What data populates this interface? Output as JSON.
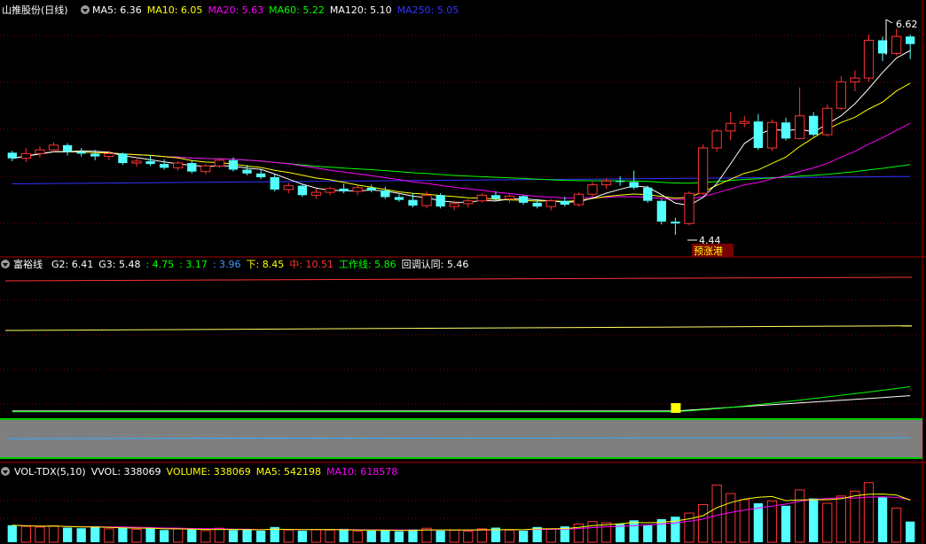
{
  "main_panel": {
    "stock_name": "山推股份(日线)",
    "ma_legend": [
      {
        "label": "MA5: 6.36",
        "color": "#ffffff"
      },
      {
        "label": "MA10: 6.05",
        "color": "#ffff00"
      },
      {
        "label": "MA20: 5.63",
        "color": "#ff00ff"
      },
      {
        "label": "MA60: 5.22",
        "color": "#00ff00"
      },
      {
        "label": "MA120: 5.10",
        "color": "#ffffff"
      },
      {
        "label": "MA250: 5.05",
        "color": "#3333ff"
      }
    ],
    "high_label": "6.62",
    "low_label": "4.44",
    "badge": "预涨港"
  },
  "indicator_panel": {
    "name": "富裕线",
    "legend": [
      {
        "label": "G2: 6.41",
        "color": "#ffffff"
      },
      {
        "label": "G3: 5.48",
        "color": "#ffffff"
      },
      {
        "label": ": 4.75",
        "color": "#00ff00"
      },
      {
        "label": ": 3.17",
        "color": "#00ff00"
      },
      {
        "label": ": 3.96",
        "color": "#4499ff"
      },
      {
        "label": "下: 8.45",
        "color": "#ffff00"
      },
      {
        "label": "中: 10.51",
        "color": "#ff3333"
      },
      {
        "label": "工作线: 5.86",
        "color": "#00ff00"
      },
      {
        "label": "回调认同: 5.46",
        "color": "#ffffff"
      }
    ]
  },
  "volume_panel": {
    "legend": [
      {
        "label": "VOL-TDX(5,10)",
        "color": "#ffffff"
      },
      {
        "label": "VVOL: 338069",
        "color": "#ffffff"
      },
      {
        "label": "VOLUME: 338069",
        "color": "#ffff00"
      },
      {
        "label": "MA5: 542198",
        "color": "#ffff00"
      },
      {
        "label": "MA10: 618578",
        "color": "#ff00ff"
      }
    ]
  },
  "colors": {
    "up": "#ff3333",
    "down": "#54ffff",
    "grid": "#7a0000",
    "ma5": "#ffffff",
    "ma10": "#ffff00",
    "ma20": "#ff00ff",
    "ma60": "#00ff00",
    "ma250": "#3333ff"
  },
  "chart_data": {
    "type": "candlestick",
    "ohlc": [
      [
        5.31,
        5.33,
        5.22,
        5.25
      ],
      [
        5.25,
        5.36,
        5.21,
        5.3
      ],
      [
        5.3,
        5.38,
        5.26,
        5.34
      ],
      [
        5.34,
        5.42,
        5.31,
        5.39
      ],
      [
        5.39,
        5.41,
        5.28,
        5.32
      ],
      [
        5.32,
        5.36,
        5.27,
        5.3
      ],
      [
        5.3,
        5.34,
        5.23,
        5.27
      ],
      [
        5.27,
        5.33,
        5.23,
        5.3
      ],
      [
        5.3,
        5.31,
        5.18,
        5.2
      ],
      [
        5.2,
        5.26,
        5.16,
        5.22
      ],
      [
        5.22,
        5.28,
        5.17,
        5.19
      ],
      [
        5.19,
        5.24,
        5.13,
        5.15
      ],
      [
        5.15,
        5.22,
        5.12,
        5.2
      ],
      [
        5.2,
        5.23,
        5.09,
        5.11
      ],
      [
        5.11,
        5.19,
        5.08,
        5.17
      ],
      [
        5.17,
        5.25,
        5.15,
        5.23
      ],
      [
        5.23,
        5.26,
        5.11,
        5.13
      ],
      [
        5.13,
        5.18,
        5.07,
        5.09
      ],
      [
        5.09,
        5.13,
        5.03,
        5.05
      ],
      [
        5.05,
        5.08,
        4.9,
        4.92
      ],
      [
        4.92,
        4.99,
        4.88,
        4.96
      ],
      [
        4.96,
        4.97,
        4.84,
        4.86
      ],
      [
        4.86,
        4.93,
        4.82,
        4.89
      ],
      [
        4.89,
        4.95,
        4.86,
        4.93
      ],
      [
        4.93,
        4.98,
        4.88,
        4.9
      ],
      [
        4.9,
        4.96,
        4.86,
        4.94
      ],
      [
        4.94,
        4.97,
        4.89,
        4.91
      ],
      [
        4.91,
        4.95,
        4.82,
        4.84
      ],
      [
        4.84,
        4.87,
        4.79,
        4.81
      ],
      [
        4.81,
        4.88,
        4.73,
        4.75
      ],
      [
        4.75,
        4.9,
        4.72,
        4.86
      ],
      [
        4.86,
        4.88,
        4.72,
        4.74
      ],
      [
        4.74,
        4.8,
        4.7,
        4.77
      ],
      [
        4.77,
        4.82,
        4.73,
        4.8
      ],
      [
        4.8,
        4.88,
        4.78,
        4.86
      ],
      [
        4.86,
        4.9,
        4.8,
        4.82
      ],
      [
        4.82,
        4.87,
        4.78,
        4.85
      ],
      [
        4.85,
        4.86,
        4.76,
        4.78
      ],
      [
        4.78,
        4.82,
        4.72,
        4.74
      ],
      [
        4.74,
        4.82,
        4.7,
        4.8
      ],
      [
        4.8,
        4.84,
        4.74,
        4.76
      ],
      [
        4.76,
        4.89,
        4.74,
        4.87
      ],
      [
        4.87,
        5.0,
        4.84,
        4.97
      ],
      [
        4.97,
        5.04,
        4.93,
        5.01
      ],
      [
        5.01,
        5.06,
        4.96,
        5.0
      ],
      [
        5.0,
        5.12,
        4.92,
        4.94
      ],
      [
        4.94,
        4.96,
        4.78,
        4.8
      ],
      [
        4.8,
        4.82,
        4.55,
        4.58
      ],
      [
        4.58,
        4.62,
        4.44,
        4.56
      ],
      [
        4.56,
        4.9,
        4.54,
        4.88
      ],
      [
        4.88,
        5.4,
        4.86,
        5.36
      ],
      [
        5.36,
        5.56,
        5.32,
        5.54
      ],
      [
        5.54,
        5.74,
        5.44,
        5.62
      ],
      [
        5.62,
        5.7,
        5.58,
        5.64
      ],
      [
        5.64,
        5.72,
        5.34,
        5.36
      ],
      [
        5.36,
        5.66,
        5.33,
        5.63
      ],
      [
        5.63,
        5.68,
        5.44,
        5.46
      ],
      [
        5.46,
        6.0,
        5.45,
        5.7
      ],
      [
        5.7,
        5.74,
        5.48,
        5.5
      ],
      [
        5.5,
        5.82,
        5.48,
        5.78
      ],
      [
        5.78,
        6.12,
        5.76,
        6.06
      ],
      [
        6.06,
        6.18,
        5.96,
        6.1
      ],
      [
        6.1,
        6.56,
        6.06,
        6.5
      ],
      [
        6.5,
        6.54,
        6.28,
        6.36
      ],
      [
        6.36,
        6.62,
        6.34,
        6.54
      ],
      [
        6.54,
        6.56,
        6.3,
        6.46
      ]
    ],
    "volume": [
      2.8,
      2.6,
      2.5,
      2.7,
      2.4,
      2.3,
      2.6,
      2.2,
      2.4,
      2.1,
      2.3,
      2.0,
      2.2,
      2.1,
      1.9,
      2.3,
      2.0,
      2.1,
      1.9,
      2.5,
      2.0,
      1.9,
      2.1,
      2.0,
      2.2,
      1.8,
      1.9,
      2.0,
      1.8,
      2.1,
      2.3,
      1.9,
      2.0,
      1.8,
      2.2,
      2.4,
      2.0,
      1.9,
      2.5,
      2.2,
      2.6,
      3.0,
      3.4,
      3.2,
      3.0,
      3.6,
      2.8,
      3.8,
      4.2,
      4.8,
      6.2,
      9.4,
      8.0,
      7.0,
      6.4,
      6.8,
      6.0,
      8.6,
      7.2,
      6.4,
      7.6,
      8.4,
      9.8,
      7.4,
      5.6,
      3.4
    ],
    "indicator_levels": {
      "中": 10.51,
      "下": 8.45,
      "G3": 5.48,
      "工作线": 5.86,
      "回调认同": 5.46
    }
  }
}
